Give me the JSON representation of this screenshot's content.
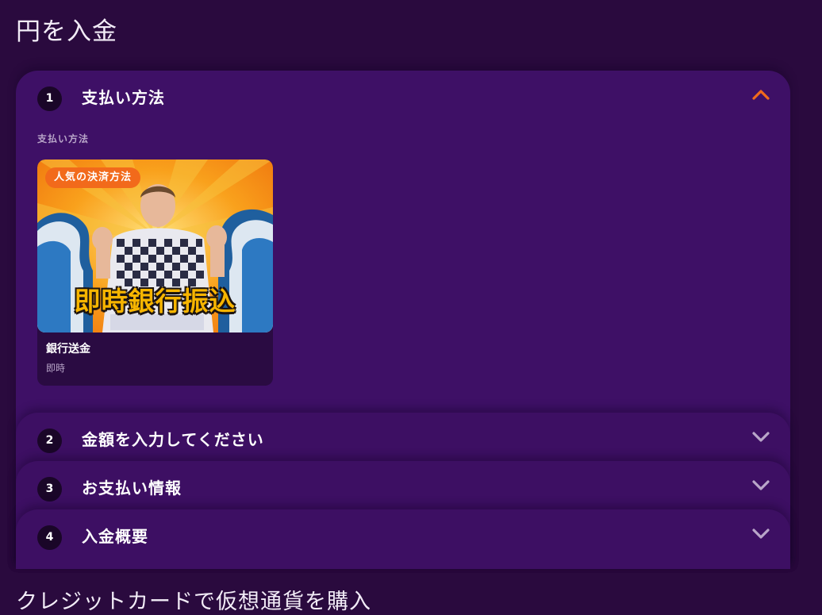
{
  "page": {
    "title": "円を入金"
  },
  "colors": {
    "background": "#2a0a3e",
    "panel": "#3d0f63",
    "accent_orange": "#f26a1b",
    "chevron_inactive": "#b9a6c9"
  },
  "steps": [
    {
      "number": "1",
      "title": "支払い方法",
      "expanded": true,
      "icon": "chevron-up-icon"
    },
    {
      "number": "2",
      "title": "金額を入力してください",
      "expanded": false,
      "icon": "chevron-down-icon"
    },
    {
      "number": "3",
      "title": "お支払い情報",
      "expanded": false,
      "icon": "chevron-down-icon"
    },
    {
      "number": "4",
      "title": "入金概要",
      "expanded": false,
      "icon": "chevron-down-icon"
    }
  ],
  "payment_section": {
    "label": "支払い方法",
    "methods": [
      {
        "badge": "人気の決済方法",
        "banner_text": "即時銀行振込",
        "name": "銀行送金",
        "speed": "即時"
      }
    ]
  },
  "footer": {
    "heading": "クレジットカードで仮想通貨を購入"
  }
}
